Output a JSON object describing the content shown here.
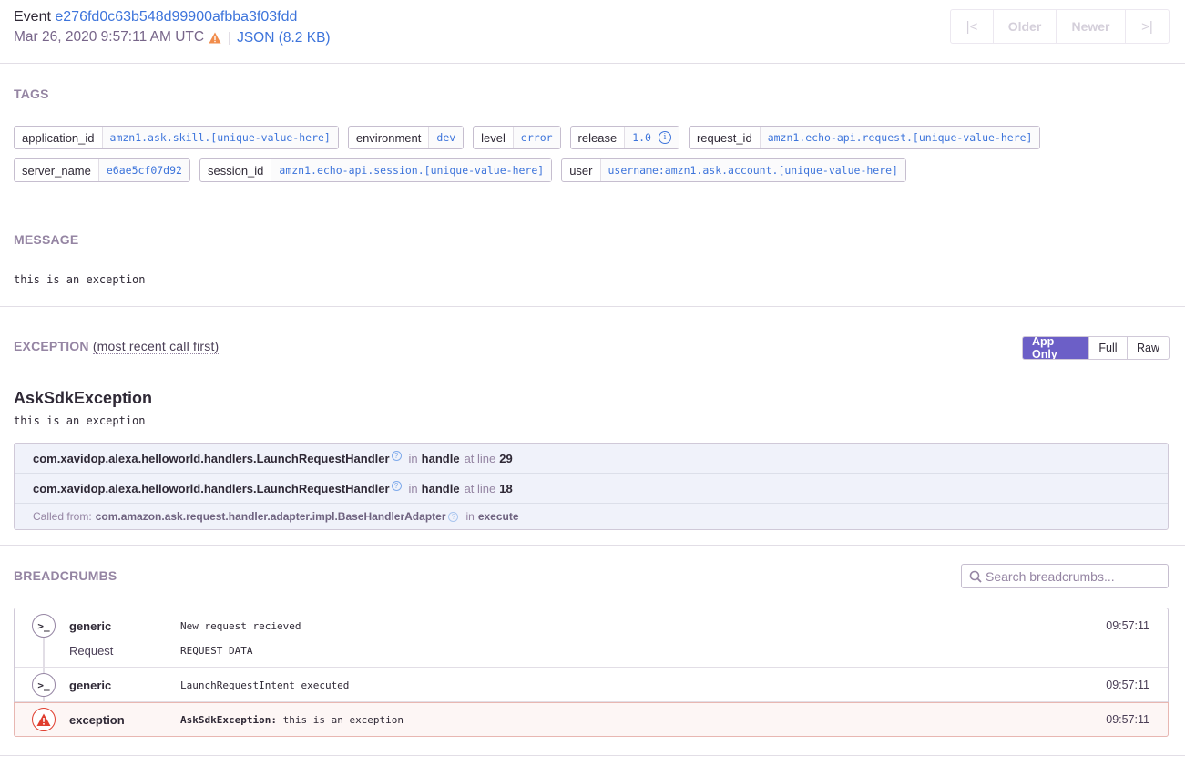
{
  "header": {
    "event_label": "Event",
    "event_id": "e276fd0c63b548d99900afbba3f03fdd",
    "date": "Mar 26, 2020 9:57:11 AM UTC",
    "warning_icon": "warning-icon",
    "json_link": "JSON (8.2 KB)",
    "nav": {
      "first": "⇤",
      "older": "Older",
      "newer": "Newer",
      "last": "⇥"
    }
  },
  "tags": {
    "title": "TAGS",
    "rows": [
      [
        {
          "key": "application_id",
          "value": "amzn1.ask.skill.[unique-value-here]"
        },
        {
          "key": "environment",
          "value": "dev"
        },
        {
          "key": "level",
          "value": "error"
        },
        {
          "key": "release",
          "value": "1.0",
          "info": true
        },
        {
          "key": "request_id",
          "value": "amzn1.echo-api.request.[unique-value-here]"
        }
      ],
      [
        {
          "key": "server_name",
          "value": "e6ae5cf07d92"
        },
        {
          "key": "session_id",
          "value": "amzn1.echo-api.session.[unique-value-here]"
        },
        {
          "key": "user",
          "value": "username:amzn1.ask.account.[unique-value-here]"
        }
      ]
    ]
  },
  "message": {
    "title": "MESSAGE",
    "text": "this is an exception"
  },
  "exception": {
    "title": "EXCEPTION",
    "subtitle": "(most recent call first)",
    "toggle": {
      "app_only": "App Only",
      "full": "Full",
      "raw": "Raw",
      "active": "app_only"
    },
    "type": "AskSdkException",
    "value": "this is an exception",
    "frames": [
      {
        "function_path": "com.xavidop.alexa.helloworld.handlers.LaunchRequestHandler",
        "in": "in",
        "method": "handle",
        "at_line": "at line",
        "line": "29"
      },
      {
        "function_path": "com.xavidop.alexa.helloworld.handlers.LaunchRequestHandler",
        "in": "in",
        "method": "handle",
        "at_line": "at line",
        "line": "18"
      }
    ],
    "called_from": {
      "label": "Called from:",
      "path": "com.amazon.ask.request.handler.adapter.impl.BaseHandlerAdapter",
      "in": "in",
      "method": "execute"
    }
  },
  "breadcrumbs": {
    "title": "BREADCRUMBS",
    "search_placeholder": "Search breadcrumbs...",
    "items": [
      {
        "category": "generic",
        "message": "New request recieved",
        "data_label": "Request",
        "data_value": "REQUEST DATA",
        "time": "09:57:11",
        "type": "default"
      },
      {
        "category": "generic",
        "message": "LaunchRequestIntent executed",
        "time": "09:57:11",
        "type": "default"
      },
      {
        "category": "exception",
        "message_type": "AskSdkException:",
        "message": "this is an exception",
        "time": "09:57:11",
        "type": "error"
      }
    ]
  },
  "colors": {
    "accent": "#6c5fc7",
    "link": "#3d74db",
    "error": "#e03e2f",
    "warning": "#f18c4b"
  }
}
